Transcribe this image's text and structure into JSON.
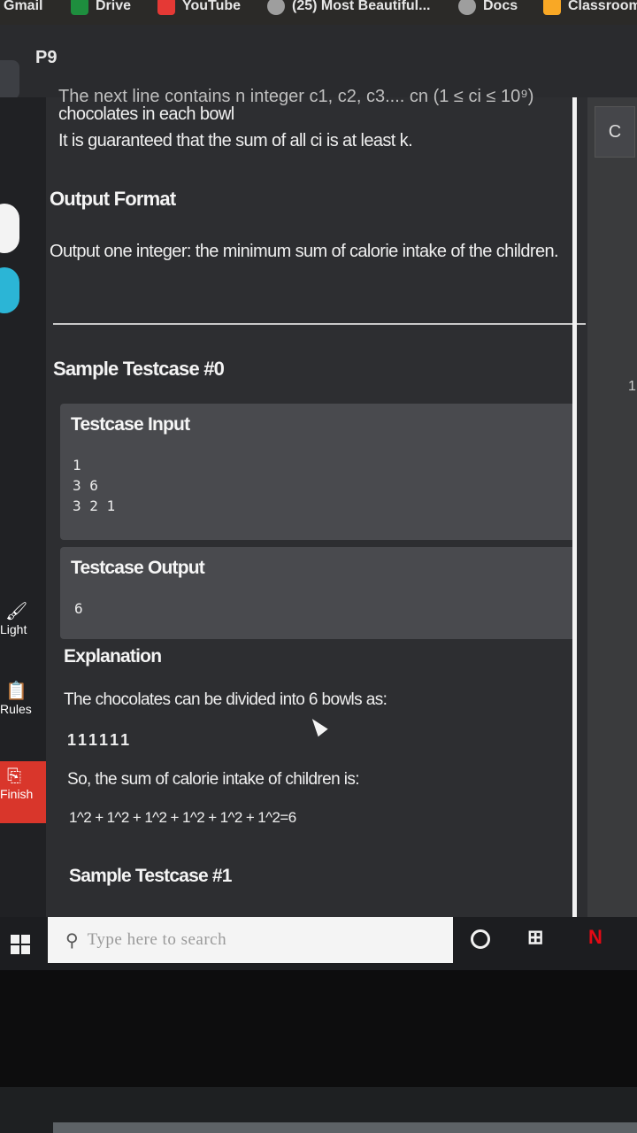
{
  "bookmarks": [
    {
      "label": "Gmail",
      "color": "#c5221f"
    },
    {
      "label": "Drive",
      "color": "#1e8e3e"
    },
    {
      "label": "YouTube",
      "color": "#e53935"
    },
    {
      "label": "(25) Most Beautiful...",
      "color": "#9e9e9e"
    },
    {
      "label": "Docs",
      "color": "#9e9e9e"
    },
    {
      "label": "Classroom",
      "color": "#f9a825"
    }
  ],
  "tab": {
    "title": "P9"
  },
  "sidebar": {
    "light_label": "Light",
    "rules_label": "Rules",
    "finish_label": "Finish",
    "finish_color": "#d9362b"
  },
  "problem": {
    "cut_line": "The next line contains n integer c1, c2, c3.... cn (1 ≤ ci ≤ 10⁹)",
    "input_line1": "chocolates in each bowl",
    "input_line2": "It is guaranteed that the sum of all ci is at least k.",
    "output_heading": "Output Format",
    "output_text": "Output one integer: the minimum sum of calorie intake of the children.",
    "sample0": {
      "heading": "Sample Testcase #0",
      "input_title": "Testcase Input",
      "input_lines": [
        "1",
        "3 6",
        "3 2 1"
      ],
      "output_title": "Testcase Output",
      "output_value": "6"
    },
    "explanation": {
      "heading": "Explanation",
      "line1": "The chocolates can be divided into 6 bowls as:",
      "bowls": "111111",
      "line2": "So, the sum of calorie intake of children is:",
      "formula": "1^2 + 1^2 + 1^2 + 1^2 + 1^2 + 1^2=6"
    },
    "sample1_heading": "Sample Testcase #1"
  },
  "right_panel": {
    "tab_label": "C",
    "number": "1"
  },
  "taskbar": {
    "search_placeholder": "Type here to search"
  }
}
